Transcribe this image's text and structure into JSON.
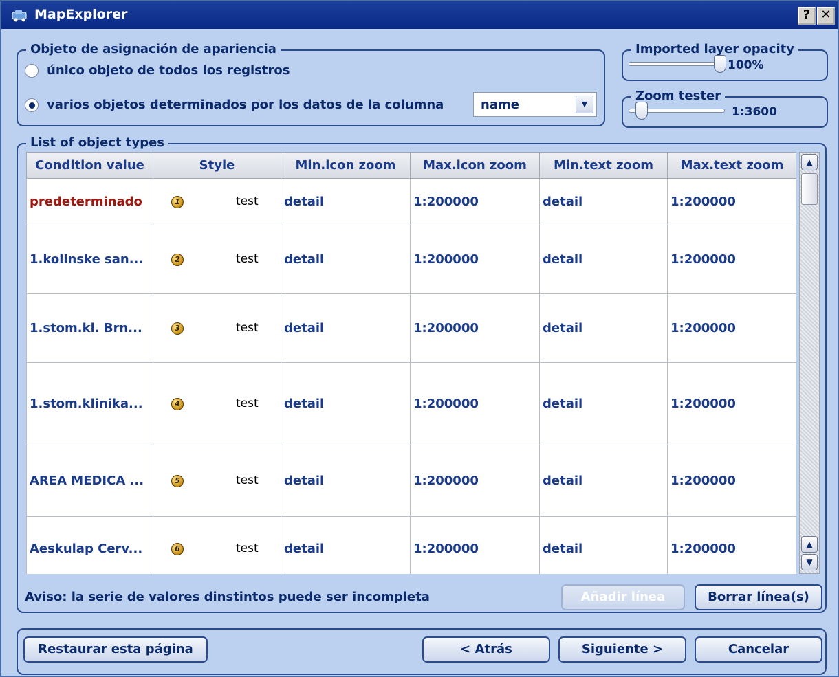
{
  "window": {
    "title": "MapExplorer",
    "help_label": "?",
    "close_label": "✕"
  },
  "appearance": {
    "legend": "Objeto de asignación de apariencia",
    "option_single": "único objeto de todos los registros",
    "option_multiple": "varios objetos determinados por los datos de la columna",
    "selected_option": "option_multiple",
    "column_select": "name"
  },
  "opacity": {
    "legend": "Imported layer opacity",
    "value_label": "100%",
    "level": 1.0
  },
  "zoom_tester": {
    "legend": "Zoom tester",
    "value_label": "1:3600",
    "level": 0.08
  },
  "object_types": {
    "legend": "List of object types",
    "columns": [
      "Condition value",
      "Style",
      "Min.icon zoom",
      "Max.icon zoom",
      "Min.text zoom",
      "Max.text zoom"
    ],
    "rows": [
      {
        "condition": "predeterminado",
        "badge": "1",
        "style": "test",
        "min_icon": "detail",
        "max_icon": "1:200000",
        "min_text": "detail",
        "max_text": "1:200000",
        "default": true
      },
      {
        "condition": "1.kolinske san...",
        "badge": "2",
        "style": "test",
        "min_icon": "detail",
        "max_icon": "1:200000",
        "min_text": "detail",
        "max_text": "1:200000",
        "default": false
      },
      {
        "condition": "1.stom.kl. Brn...",
        "badge": "3",
        "style": "test",
        "min_icon": "detail",
        "max_icon": "1:200000",
        "min_text": "detail",
        "max_text": "1:200000",
        "default": false
      },
      {
        "condition": "1.stom.klinika...",
        "badge": "4",
        "style": "test",
        "min_icon": "detail",
        "max_icon": "1:200000",
        "min_text": "detail",
        "max_text": "1:200000",
        "default": false
      },
      {
        "condition": "AREA MEDICA ...",
        "badge": "5",
        "style": "test",
        "min_icon": "detail",
        "max_icon": "1:200000",
        "min_text": "detail",
        "max_text": "1:200000",
        "default": false
      },
      {
        "condition": "Aeskulap Cerv...",
        "badge": "6",
        "style": "test",
        "min_icon": "detail",
        "max_icon": "1:200000",
        "min_text": "detail",
        "max_text": "1:200000",
        "default": false
      }
    ]
  },
  "notice": "Aviso: la serie de valores dinstintos puede ser incompleta",
  "buttons": {
    "add_line": "Añadir línea",
    "delete_lines": "Borrar línea(s)",
    "restore": "Restaurar esta página",
    "back_prefix": "< ",
    "back_key": "A",
    "back_rest": "trás",
    "next_key": "S",
    "next_rest": "iguiente >",
    "cancel_key": "C",
    "cancel_rest": "ancelar"
  },
  "colors": {
    "title_bar": "#0a2a86",
    "panel": "#bcd0f0",
    "text": "#0b2a6b",
    "default_condition": "#a01810"
  }
}
